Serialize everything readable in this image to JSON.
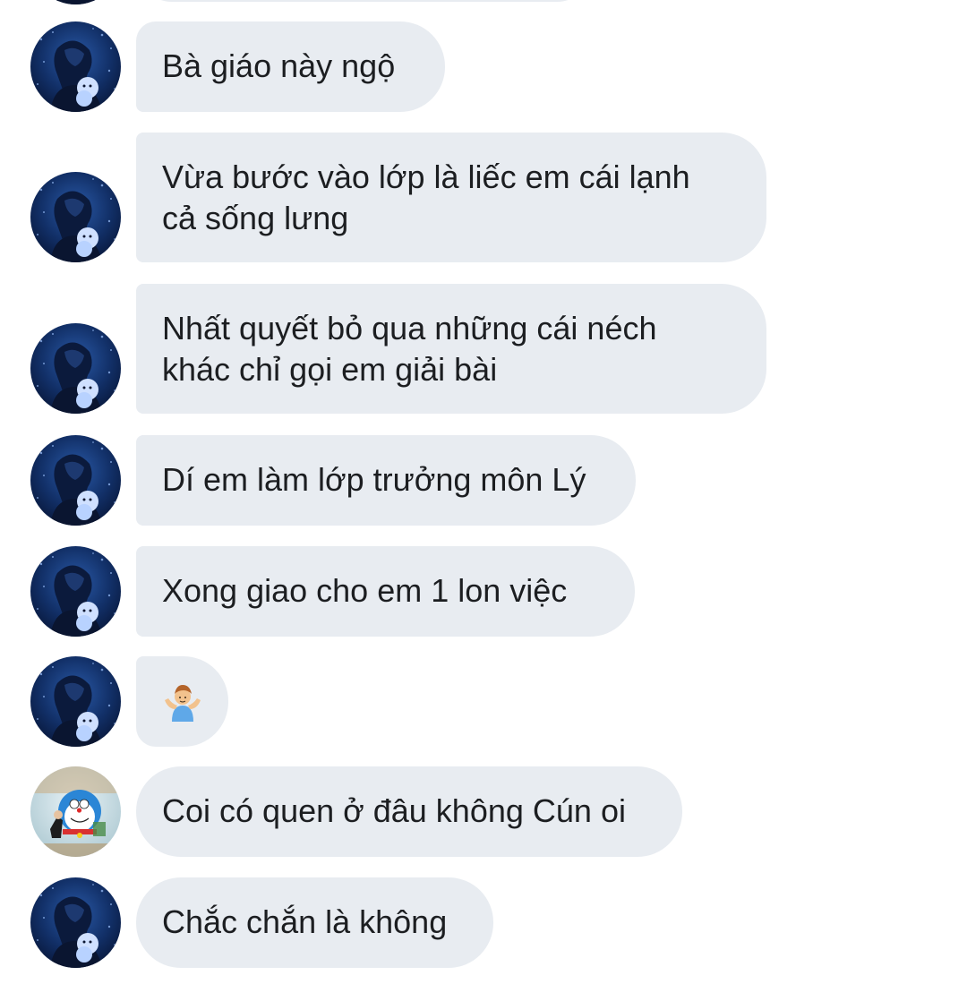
{
  "conversation": {
    "messages": [
      {
        "sender": "friend",
        "text": "Bà giáo này ngộ"
      },
      {
        "sender": "friend",
        "text": "Vừa bước vào lớp là liếc em cái lạnh\ncả sống lưng"
      },
      {
        "sender": "friend",
        "text": "Nhất quyết bỏ qua những cái néch\nkhác chỉ gọi em giải bài"
      },
      {
        "sender": "friend",
        "text": "Dí em làm lớp trưởng môn Lý"
      },
      {
        "sender": "friend",
        "text": "Xong giao cho em 1 lon việc"
      },
      {
        "sender": "friend",
        "type": "emoji",
        "emoji": "person-shrugging"
      },
      {
        "sender": "other",
        "text": "Coi có quen ở đâu không Cún oi"
      },
      {
        "sender": "friend",
        "text": "Chắc chắn là không"
      }
    ]
  },
  "colors": {
    "bubble": "#e8ecf1",
    "text": "#1c1e21",
    "background": "#ffffff"
  }
}
